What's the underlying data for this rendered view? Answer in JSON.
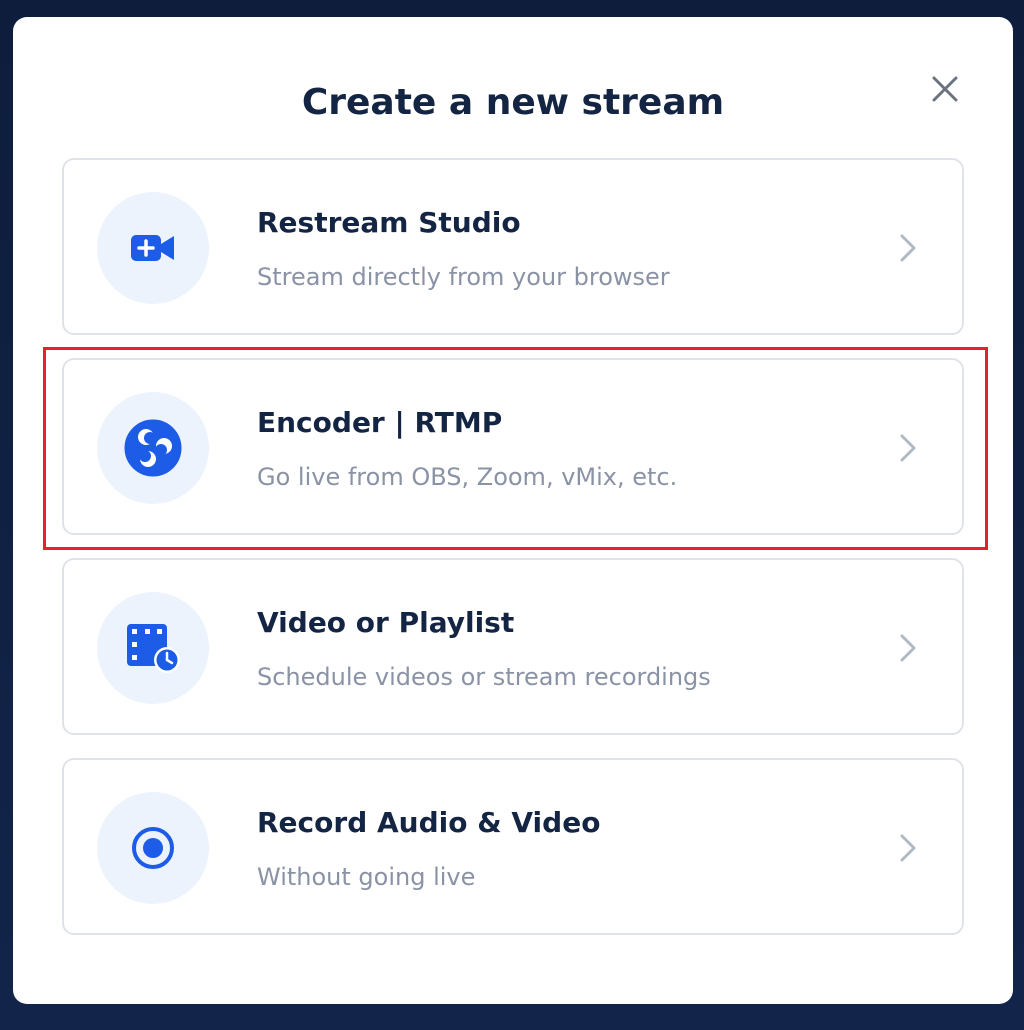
{
  "dialog": {
    "title": "Create a new stream",
    "close_icon": "close-icon"
  },
  "options": [
    {
      "title": "Restream Studio",
      "subtitle": "Stream directly from your browser",
      "icon": "video-camera-plus-icon"
    },
    {
      "title": "Encoder | RTMP",
      "subtitle": "Go live from OBS, Zoom, vMix, etc.",
      "icon": "obs-logo-icon",
      "highlighted": true
    },
    {
      "title": "Video or Playlist",
      "subtitle": "Schedule videos or stream recordings",
      "icon": "film-schedule-icon"
    },
    {
      "title": "Record Audio & Video",
      "subtitle": "Without going live",
      "icon": "record-icon"
    }
  ],
  "colors": {
    "accent": "#1d5ce6",
    "highlight": "#e0232d",
    "title": "#142544",
    "subtitle": "#8a93a6",
    "icon_bg": "#edf3fc"
  }
}
